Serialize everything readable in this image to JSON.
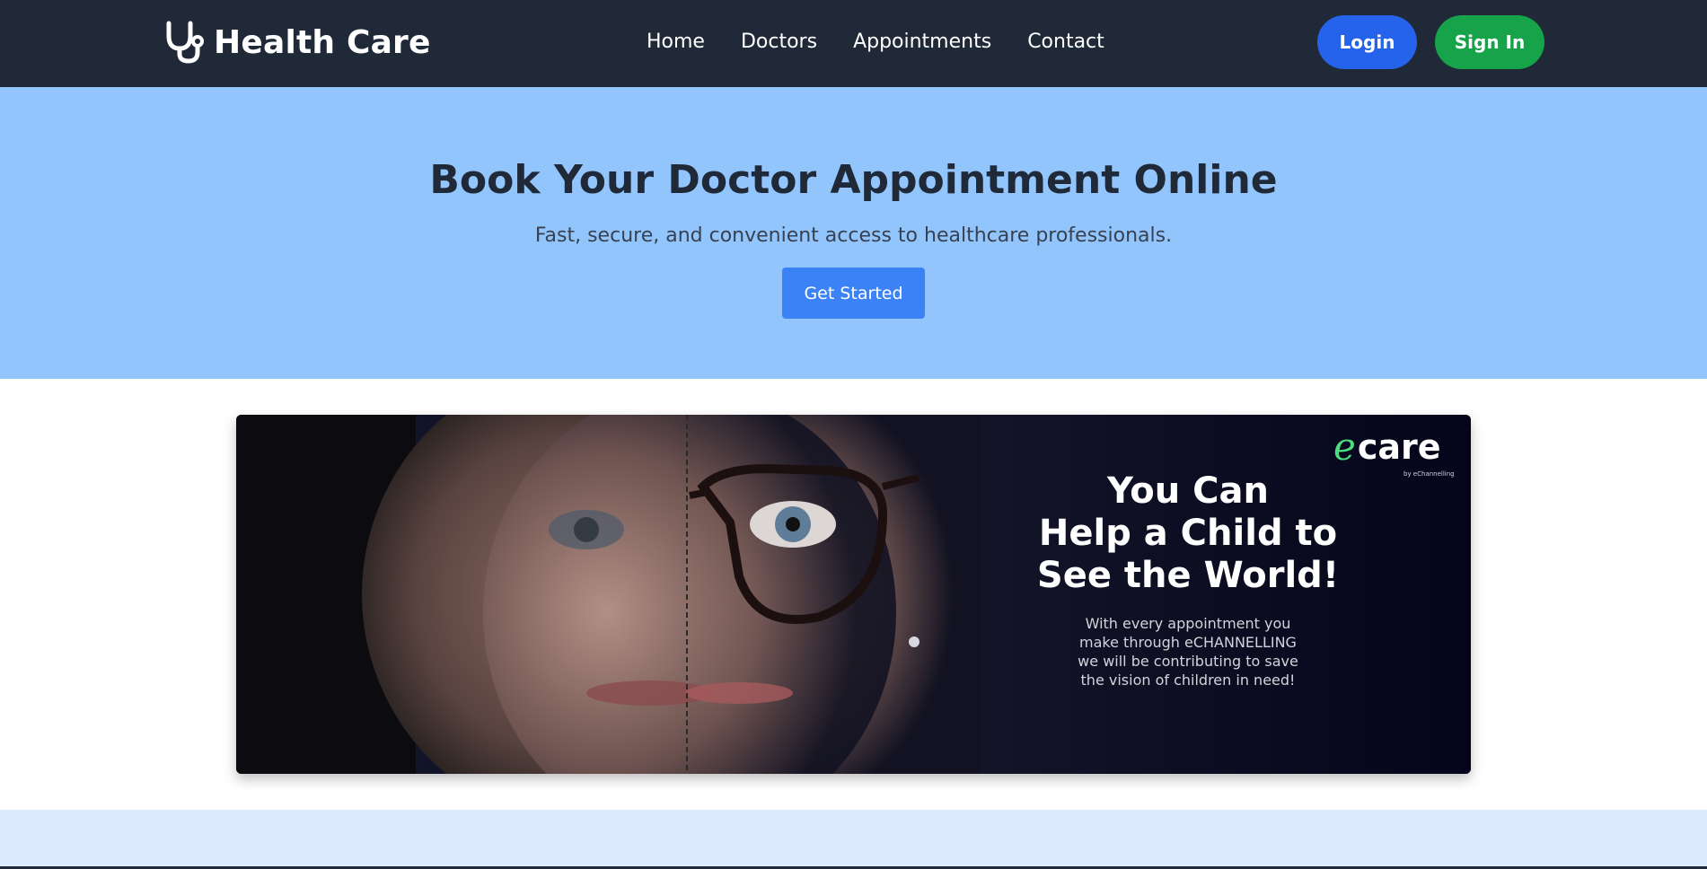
{
  "navbar": {
    "brand": "Health Care",
    "brand_icon": "stethoscope-icon",
    "links": [
      "Home",
      "Doctors",
      "Appointments",
      "Contact"
    ],
    "login_label": "Login",
    "signin_label": "Sign In",
    "colors": {
      "background": "#1f2937",
      "login": "#2563eb",
      "signin": "#16a34a"
    }
  },
  "hero": {
    "title": "Book Your Doctor Appointment Online",
    "subtitle": "Fast, secure, and convenient access to healthcare professionals.",
    "cta_label": "Get Started",
    "colors": {
      "background": "#93c5fd",
      "cta": "#3b82f6"
    }
  },
  "banner": {
    "logo_e": "e",
    "logo_care": "care",
    "logo_by": "by eChannelling",
    "headline_lines": [
      "You Can",
      "Help a Child to",
      "See the World!"
    ],
    "sub_lines": [
      "With every appointment you",
      "make through eCHANNELLING",
      "we will be contributing to save",
      "the vision of children in need!"
    ]
  },
  "lower_section": {
    "color": "#dbeafe"
  }
}
